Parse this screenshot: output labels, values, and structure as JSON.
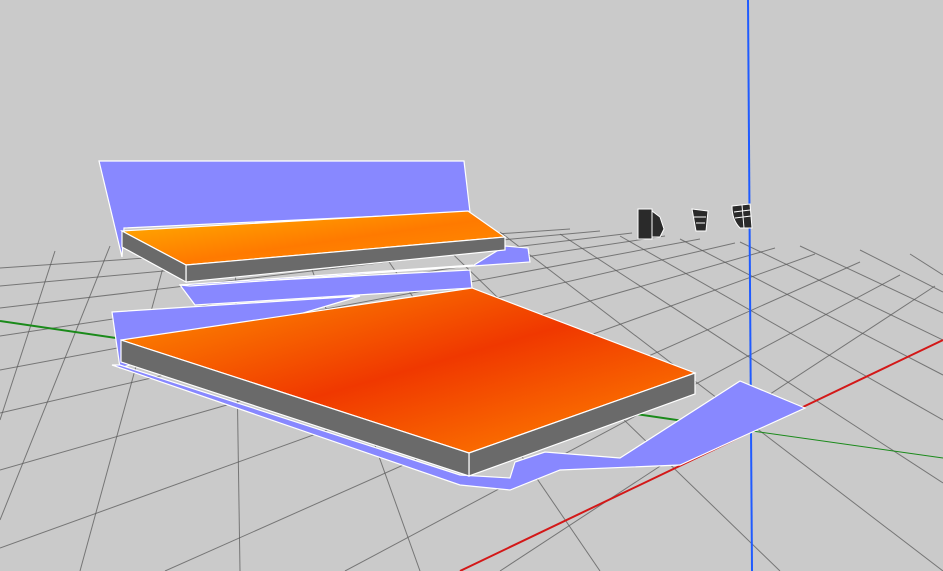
{
  "app": {
    "view": "3d-viewport"
  },
  "colors": {
    "background": "#cacaca",
    "grid": "#5a5a5a",
    "x_axis": "#d31818",
    "y_axis": "#1a8a1a",
    "z_axis": "#1f5bff",
    "panel_fill": "#8888ff",
    "slab_side": "#6a6a6a",
    "slab_top_gradient": [
      "#ffb300",
      "#ff7a00",
      "#f03a00"
    ],
    "edge": "#ffffff"
  },
  "toolbar_icons": [
    {
      "name": "view-front-icon"
    },
    {
      "name": "view-bottom-icon"
    },
    {
      "name": "view-rotate-icon"
    }
  ]
}
